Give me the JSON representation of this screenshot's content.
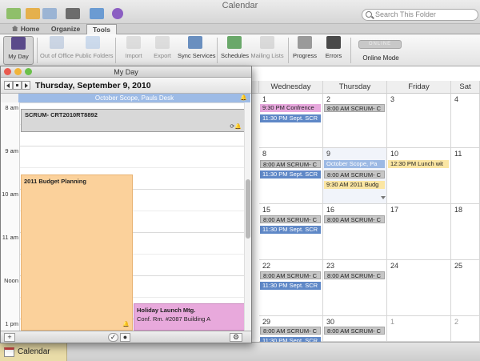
{
  "window": {
    "title": "Calendar"
  },
  "search": {
    "placeholder": "Search This Folder"
  },
  "tabs": [
    {
      "label": "Home"
    },
    {
      "label": "Organize"
    },
    {
      "label": "Tools"
    }
  ],
  "ribbon": {
    "my_day": "My Day",
    "out_of_office": "Out of Office",
    "public_folders": "Public Folders",
    "import": "Import",
    "export": "Export",
    "sync_services": "Sync Services",
    "schedules": "Schedules",
    "mailing_lists": "Mailing Lists",
    "progress": "Progress",
    "errors": "Errors",
    "online_mode": "Online Mode",
    "online_toggle": "ONLINE"
  },
  "calendar": {
    "weekdays": [
      "Wednesday",
      "Thursday",
      "Friday",
      "Sat"
    ],
    "rows": [
      {
        "days": [
          "1",
          "2",
          "3",
          "4"
        ],
        "events": {
          "wed": [
            {
              "text": "9:30 PM Confrence",
              "color": "pink"
            },
            {
              "text": "11:30 PM Sept. SCR",
              "color": "blue"
            }
          ],
          "thu": [
            {
              "text": "8:00 AM SCRUM- C",
              "color": "gray"
            }
          ]
        }
      },
      {
        "days": [
          "8",
          "9",
          "10",
          "11"
        ],
        "events": {
          "wed": [
            {
              "text": "8:00 AM SCRUM- C",
              "color": "gray"
            },
            {
              "text": "11:30 PM Sept. SCR",
              "color": "blue"
            }
          ],
          "thu": [
            {
              "text": "October Scope, Pa",
              "color": "ltblue"
            },
            {
              "text": "8:00 AM SCRUM- C",
              "color": "gray"
            },
            {
              "text": "9:30 AM 2011 Budg",
              "color": "yellow"
            }
          ],
          "fri": [
            {
              "text": "12:30 PM Lunch wit",
              "color": "yellow"
            }
          ]
        }
      },
      {
        "days": [
          "15",
          "16",
          "17",
          "18"
        ],
        "events": {
          "wed": [
            {
              "text": "8:00 AM SCRUM- C",
              "color": "gray"
            },
            {
              "text": "11:30 PM Sept. SCR",
              "color": "blue"
            }
          ],
          "thu": [
            {
              "text": "8:00 AM SCRUM- C",
              "color": "gray"
            }
          ]
        }
      },
      {
        "days": [
          "22",
          "23",
          "24",
          "25"
        ],
        "events": {
          "wed": [
            {
              "text": "8:00 AM SCRUM- C",
              "color": "gray"
            },
            {
              "text": "11:30 PM Sept. SCR",
              "color": "blue"
            }
          ],
          "thu": [
            {
              "text": "8:00 AM SCRUM- C",
              "color": "gray"
            }
          ]
        }
      },
      {
        "days": [
          "29",
          "30",
          "1",
          "2"
        ],
        "events": {
          "wed": [
            {
              "text": "8:00 AM SCRUM- C",
              "color": "gray"
            },
            {
              "text": "11:30 PM Sept. SCR",
              "color": "blue"
            }
          ],
          "thu": [
            {
              "text": "8:00 AM SCRUM- C",
              "color": "gray"
            }
          ]
        }
      }
    ]
  },
  "status_bar": {
    "calendar_label": "Calendar"
  },
  "my_day": {
    "title": "My Day",
    "date": "Thursday, September 9, 2010",
    "all_day_event": "October Scope, Pauls Desk",
    "time_labels": [
      "8 am",
      "9 am",
      "10 am",
      "11 am",
      "Noon",
      "1 pm"
    ],
    "events": {
      "scrum": "SCRUM- CRT2010RT8892",
      "budget": "2011 Budget Planning",
      "holiday_title": "Holiday Launch Mtg.",
      "holiday_location": "Conf. Rm. #2087 Building A"
    },
    "footer": {
      "add": "+"
    }
  },
  "colors": {
    "accent_blue": "#5f88c7",
    "event_pink": "#e7a8dd",
    "event_yellow": "#fbe6a3",
    "event_orange": "#fbd19b",
    "event_gray": "#c6c6c6"
  }
}
